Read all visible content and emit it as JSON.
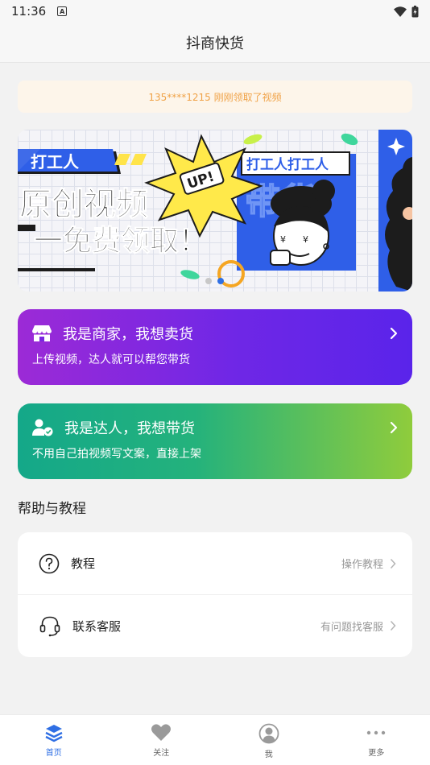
{
  "status_bar": {
    "time": "11:36",
    "notification_badge": "A"
  },
  "header": {
    "title": "抖商快货"
  },
  "notice": {
    "text": "135****1215 刚刚领取了视频"
  },
  "banner": {
    "tag_left": "打工人",
    "tag_right": "打工人打工人",
    "line1": "原创视频",
    "line2": "一免费领取！",
    "burst_text": "UP!",
    "bg_text": "带货",
    "dots": 2,
    "active_dot": 1
  },
  "cards": {
    "merchant": {
      "title": "我是商家，我想卖货",
      "subtitle": "上传视频，达人就可以帮您带货"
    },
    "influencer": {
      "title": "我是达人，我想带货",
      "subtitle": "不用自己拍视频写文案，直接上架"
    }
  },
  "help": {
    "section_title": "帮助与教程",
    "items": [
      {
        "label": "教程",
        "hint": "操作教程",
        "icon": "question-circle-icon"
      },
      {
        "label": "联系客服",
        "hint": "有问题找客服",
        "icon": "headset-icon"
      }
    ]
  },
  "tabbar": {
    "tabs": [
      {
        "label": "首页",
        "icon": "layers-icon",
        "active": true
      },
      {
        "label": "关注",
        "icon": "heart-icon",
        "active": false
      },
      {
        "label": "我",
        "icon": "user-icon",
        "active": false
      },
      {
        "label": "更多",
        "icon": "more-dots-icon",
        "active": false
      }
    ]
  },
  "colors": {
    "accent": "#2f6fe4",
    "notice_text": "#f0a247",
    "merchant": "#7a27e0",
    "influencer": "#24b27c"
  }
}
